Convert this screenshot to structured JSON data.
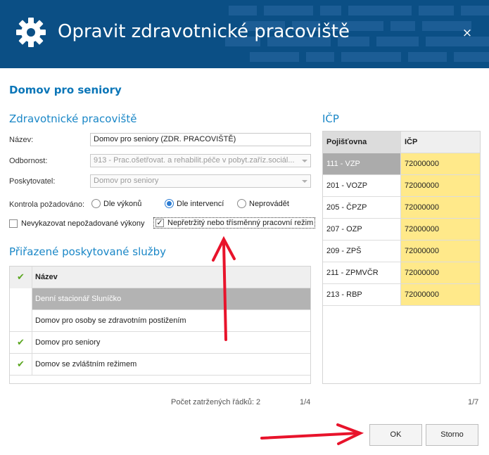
{
  "dialog": {
    "title": "Opravit zdravotnické pracoviště",
    "close_symbol": "×",
    "heading": "Domov pro seniory"
  },
  "colors": {
    "titlebar": "#0b4f85",
    "accent": "#1a87c7",
    "check_green": "#5aa61f",
    "icp_highlight": "#ffe98a",
    "annotation_arrow": "#e8132b"
  },
  "workplace": {
    "section_title": "Zdravotnické pracoviště",
    "name_label": "Název:",
    "name_value": "Domov pro seniory (ZDR. PRACOVIŠTĚ)",
    "specialty_label": "Odbornost:",
    "specialty_value": "913 - Prac.ošetřovat. a rehabilit.péče v pobyt.zaříz.sociál...",
    "provider_label": "Poskytovatel:",
    "provider_value": "Domov pro seniory",
    "control_label": "Kontrola požadováno:",
    "radio_options": [
      {
        "label": "Dle výkonů",
        "selected": false
      },
      {
        "label": "Dle intervencí",
        "selected": true
      },
      {
        "label": "Neprovádět",
        "selected": false
      }
    ],
    "checkbox_unrequired": {
      "label": "Nevykazovat nepožadované výkony",
      "checked": false
    },
    "checkbox_continuous": {
      "label": "Nepřetržitý nebo třísměnný pracovní režim",
      "checked": true,
      "check_symbol": "✓"
    }
  },
  "services": {
    "section_title": "Přiřazené poskytované služby",
    "check_symbol": "✔",
    "column_header": "Název",
    "rows": [
      {
        "name": "Denní stacionář Sluníčko",
        "checked": false,
        "selected": true
      },
      {
        "name": "Domov pro osoby se zdravotním postižením",
        "checked": false,
        "selected": false
      },
      {
        "name": "Domov pro seniory",
        "checked": true,
        "selected": false
      },
      {
        "name": "Domov se zvláštním režimem",
        "checked": true,
        "selected": false
      }
    ],
    "count_text": "Počet zatržených řádků: 2",
    "page_text": "1/4"
  },
  "icp": {
    "section_title": "IČP",
    "headers": [
      "Pojišťovna",
      "IČP"
    ],
    "rows": [
      {
        "insurer": "111 - VZP",
        "icp": "72000000",
        "selected": true
      },
      {
        "insurer": "201 - VOZP",
        "icp": "72000000",
        "selected": false
      },
      {
        "insurer": "205 - ČPZP",
        "icp": "72000000",
        "selected": false
      },
      {
        "insurer": "207 - OZP",
        "icp": "72000000",
        "selected": false
      },
      {
        "insurer": "209 - ZPŠ",
        "icp": "72000000",
        "selected": false
      },
      {
        "insurer": "211 - ZPMVČR",
        "icp": "72000000",
        "selected": false
      },
      {
        "insurer": "213 - RBP",
        "icp": "72000000",
        "selected": false
      }
    ],
    "page_text": "1/7"
  },
  "buttons": {
    "ok": "OK",
    "cancel": "Storno"
  }
}
